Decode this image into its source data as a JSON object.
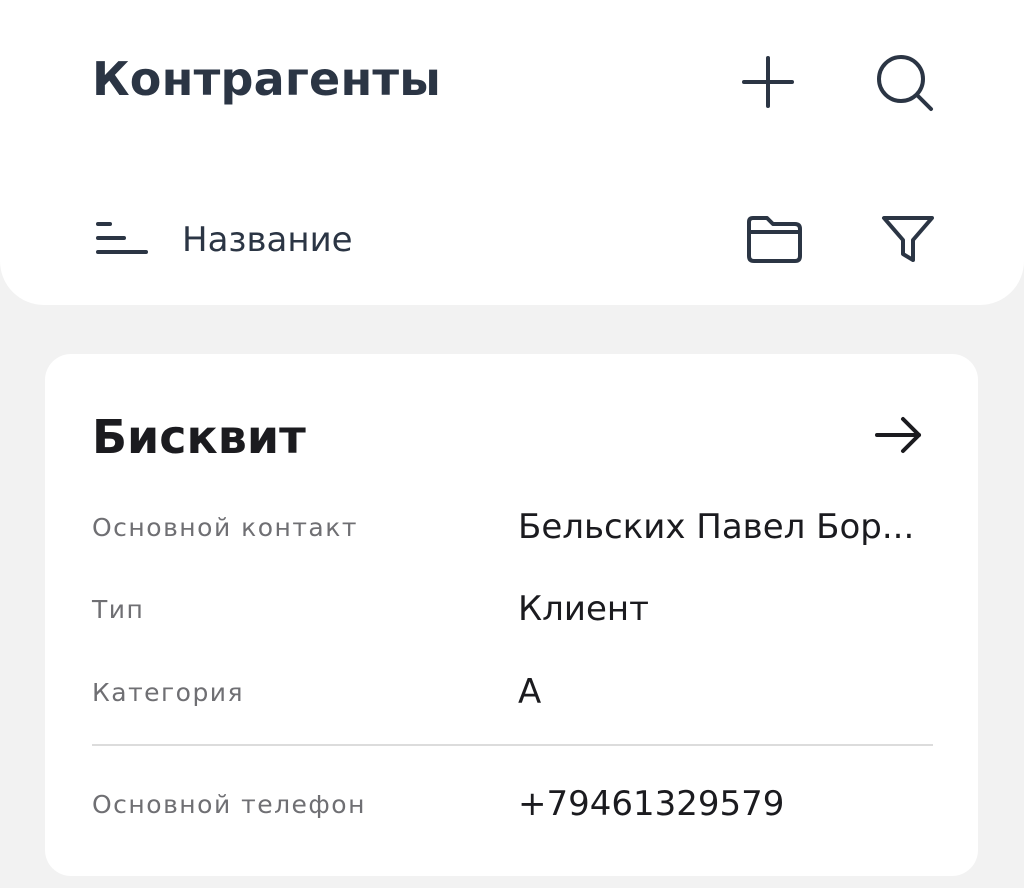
{
  "header": {
    "title": "Контрагенты",
    "add_icon": "plus-icon",
    "search_icon": "search-icon"
  },
  "toolbar": {
    "sort_icon": "sort-icon",
    "sort_label": "Название",
    "folder_icon": "folder-icon",
    "filter_icon": "filter-icon"
  },
  "card": {
    "title": "Бисквит",
    "open_icon": "arrow-right-icon",
    "rows": [
      {
        "label": "Основной контакт",
        "value": "Бельских Павел Бор..."
      },
      {
        "label": "Тип",
        "value": "Клиент"
      },
      {
        "label": "Категория",
        "value": "А"
      },
      {
        "label": "Основной телефон",
        "value": "+79461329579"
      }
    ]
  },
  "colors": {
    "background": "#f2f2f2",
    "surface": "#ffffff",
    "title_text": "#2b3544",
    "secondary_text": "#6f6f73",
    "divider": "#dcdcdc"
  }
}
